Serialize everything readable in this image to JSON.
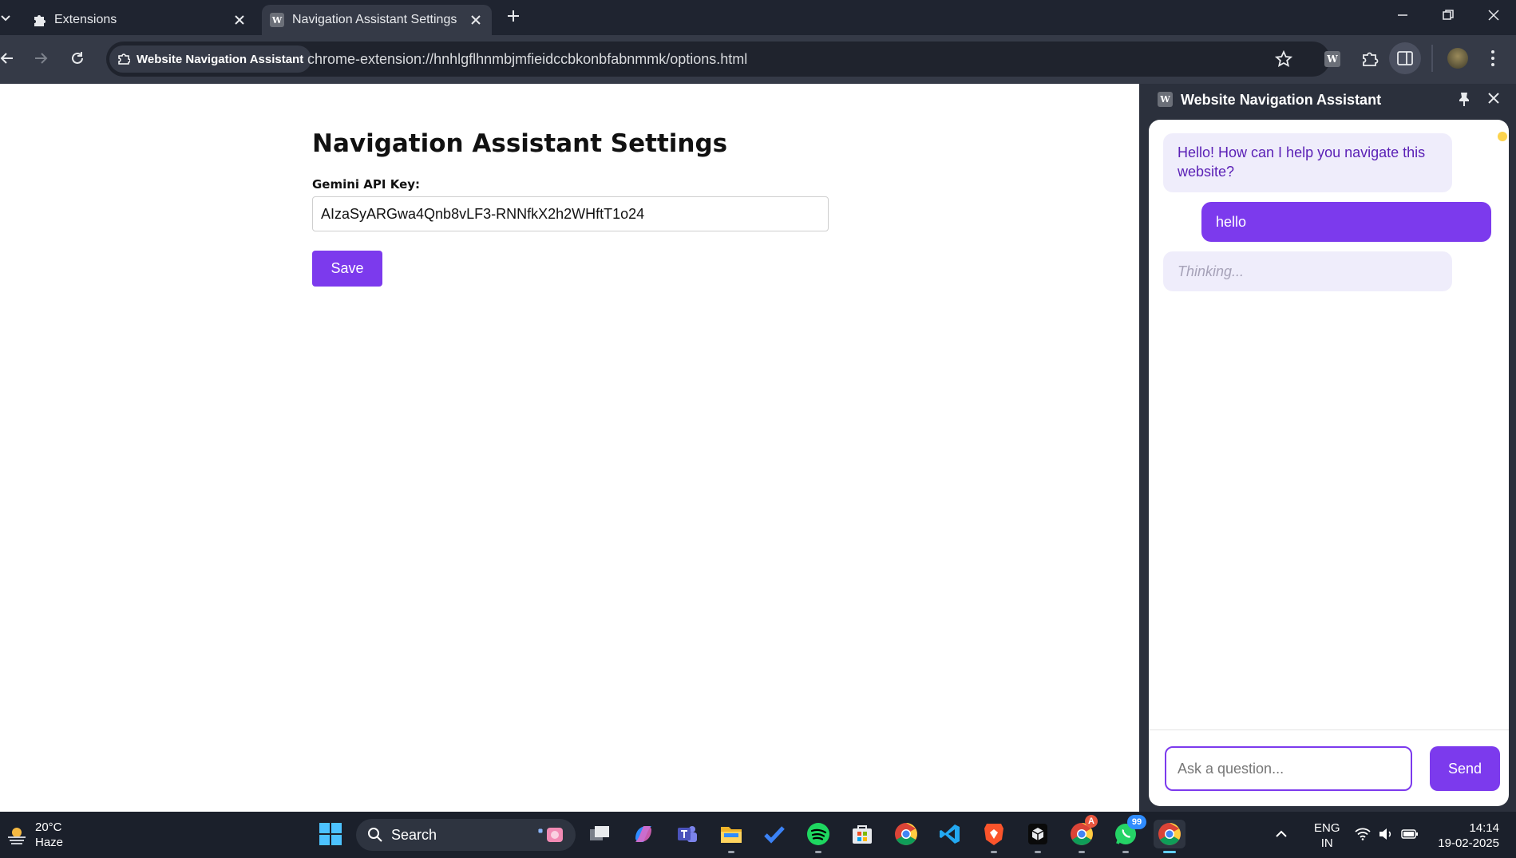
{
  "browser": {
    "tabs": [
      {
        "label": "Extensions",
        "icon": "puzzle-icon",
        "active": false
      },
      {
        "label": "Navigation Assistant Settings",
        "icon": "w-extension-icon",
        "active": true
      }
    ],
    "site_chip": "Website Navigation Assistant",
    "url": "chrome-extension://hnhlgflhnmbjmfieidccbkonbfabnmmk/options.html"
  },
  "page": {
    "title": "Navigation Assistant Settings",
    "api_key_label": "Gemini API Key:",
    "api_key_value": "AIzaSyARGwa4Qnb8vLF3-RNNfkX2h2WHftT1o24",
    "save_label": "Save"
  },
  "side_panel": {
    "title": "Website Navigation Assistant",
    "messages": [
      {
        "role": "assistant",
        "text": "Hello! How can I help you navigate this website?"
      },
      {
        "role": "user",
        "text": "hello"
      },
      {
        "role": "assistant",
        "text": "Thinking..."
      }
    ],
    "input_placeholder": "Ask a question...",
    "send_label": "Send"
  },
  "taskbar": {
    "weather_temp": "20°C",
    "weather_desc": "Haze",
    "search_label": "Search",
    "whatsapp_badge": "99",
    "chrome_badge": "A",
    "lang_line1": "ENG",
    "lang_line2": "IN",
    "time": "14:14",
    "date": "19-02-2025"
  },
  "colors": {
    "accent": "#7c3aed",
    "bot_bubble": "#efedfb",
    "browser_frame": "#1f2430",
    "toolbar": "#353a47"
  }
}
